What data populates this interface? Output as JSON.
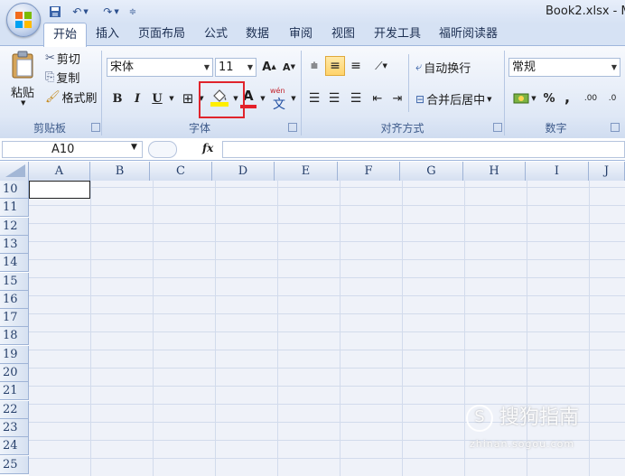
{
  "window": {
    "doc_title": "Book2.xlsx - M"
  },
  "qat": {
    "save_icon": "save-icon",
    "undo_icon": "undo-icon",
    "redo_icon": "redo-icon",
    "customize_icon": "customize-qat-icon"
  },
  "tabs": [
    "开始",
    "插入",
    "页面布局",
    "公式",
    "数据",
    "审阅",
    "视图",
    "开发工具",
    "福昕阅读器"
  ],
  "clipboard": {
    "paste": "粘贴",
    "cut": "剪切",
    "copy": "复制",
    "format_painter": "格式刷",
    "group": "剪贴板"
  },
  "font": {
    "name": "宋体",
    "size": "11",
    "bold": "B",
    "italic": "I",
    "underline": "U",
    "font_color_glyph": "A",
    "phonetic_glyph": "wén",
    "group": "字体"
  },
  "alignment": {
    "wrap_text": "自动换行",
    "merge_center": "合并后居中",
    "group": "对齐方式"
  },
  "number": {
    "format": "常规",
    "percent": "%",
    "comma": ",",
    "inc_decimal": ".00",
    "dec_decimal": ".0",
    "group": "数字"
  },
  "formula_bar": {
    "name_box": "A10",
    "fx": "fx",
    "value": ""
  },
  "columns": [
    "A",
    "B",
    "C",
    "D",
    "E",
    "F",
    "G",
    "H",
    "I",
    "J"
  ],
  "rows": [
    "10",
    "11",
    "12",
    "13",
    "14",
    "15",
    "16",
    "17",
    "18",
    "19",
    "20",
    "21",
    "22",
    "23",
    "24",
    "25"
  ],
  "selected_cell": "A10",
  "highlight": {
    "target": "fill-color-button",
    "color": "#e0242c"
  },
  "watermark": {
    "text": "搜狗指南",
    "sub": "zhinan.sogou.com"
  },
  "colors": {
    "accent": "#3d5a8a",
    "fill_yellow": "#ffee00",
    "font_red": "#e4202a"
  }
}
